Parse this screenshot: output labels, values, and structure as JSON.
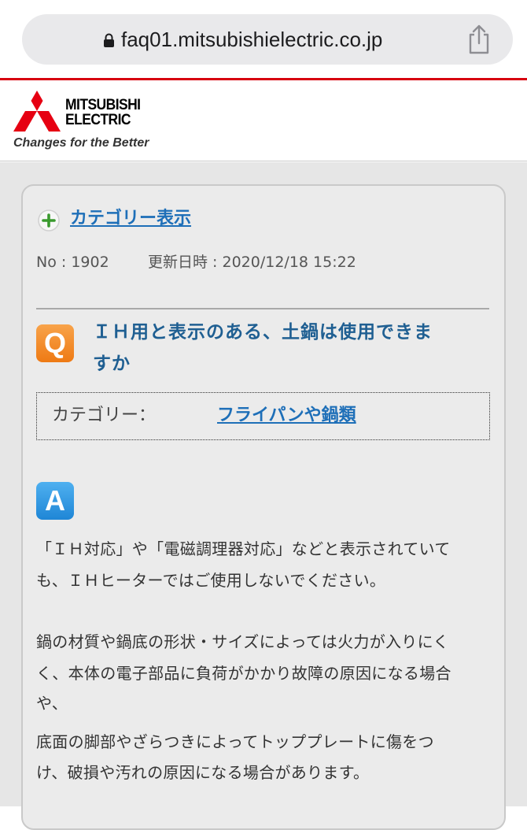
{
  "browser": {
    "url": "faq01.mitsubishielectric.co.jp"
  },
  "header": {
    "brand_line1": "MITSUBISHI",
    "brand_line2": "ELECTRIC",
    "tagline": "Changes for the Better",
    "brand_color": "#d7000f"
  },
  "faq": {
    "category_link": "カテゴリー表示",
    "number_label": "No : 1902",
    "updated_label": "更新日時 : 2020/12/18 15:22",
    "q_badge": "Q",
    "question_line1": "ＩＨ用と表示のある、土鍋は使用できま",
    "question_line2": "すか",
    "category_label": "カテゴリー：",
    "category_value": "フライパンや鍋類",
    "a_badge": "A",
    "answer_lines": [
      "「ＩＨ対応」や「電磁調理器対応」などと表示されていて",
      "も、ＩＨヒーターではご使用しないでください。",
      "鍋の材質や鍋底の形状・サイズによっては火力が入りにく",
      "く、本体の電子部品に負荷がかかり故障の原因になる場合",
      "や、",
      "底面の脚部やざらつきによってトッププレートに傷をつ",
      "け、破損や汚れの原因になる場合があります。"
    ]
  }
}
